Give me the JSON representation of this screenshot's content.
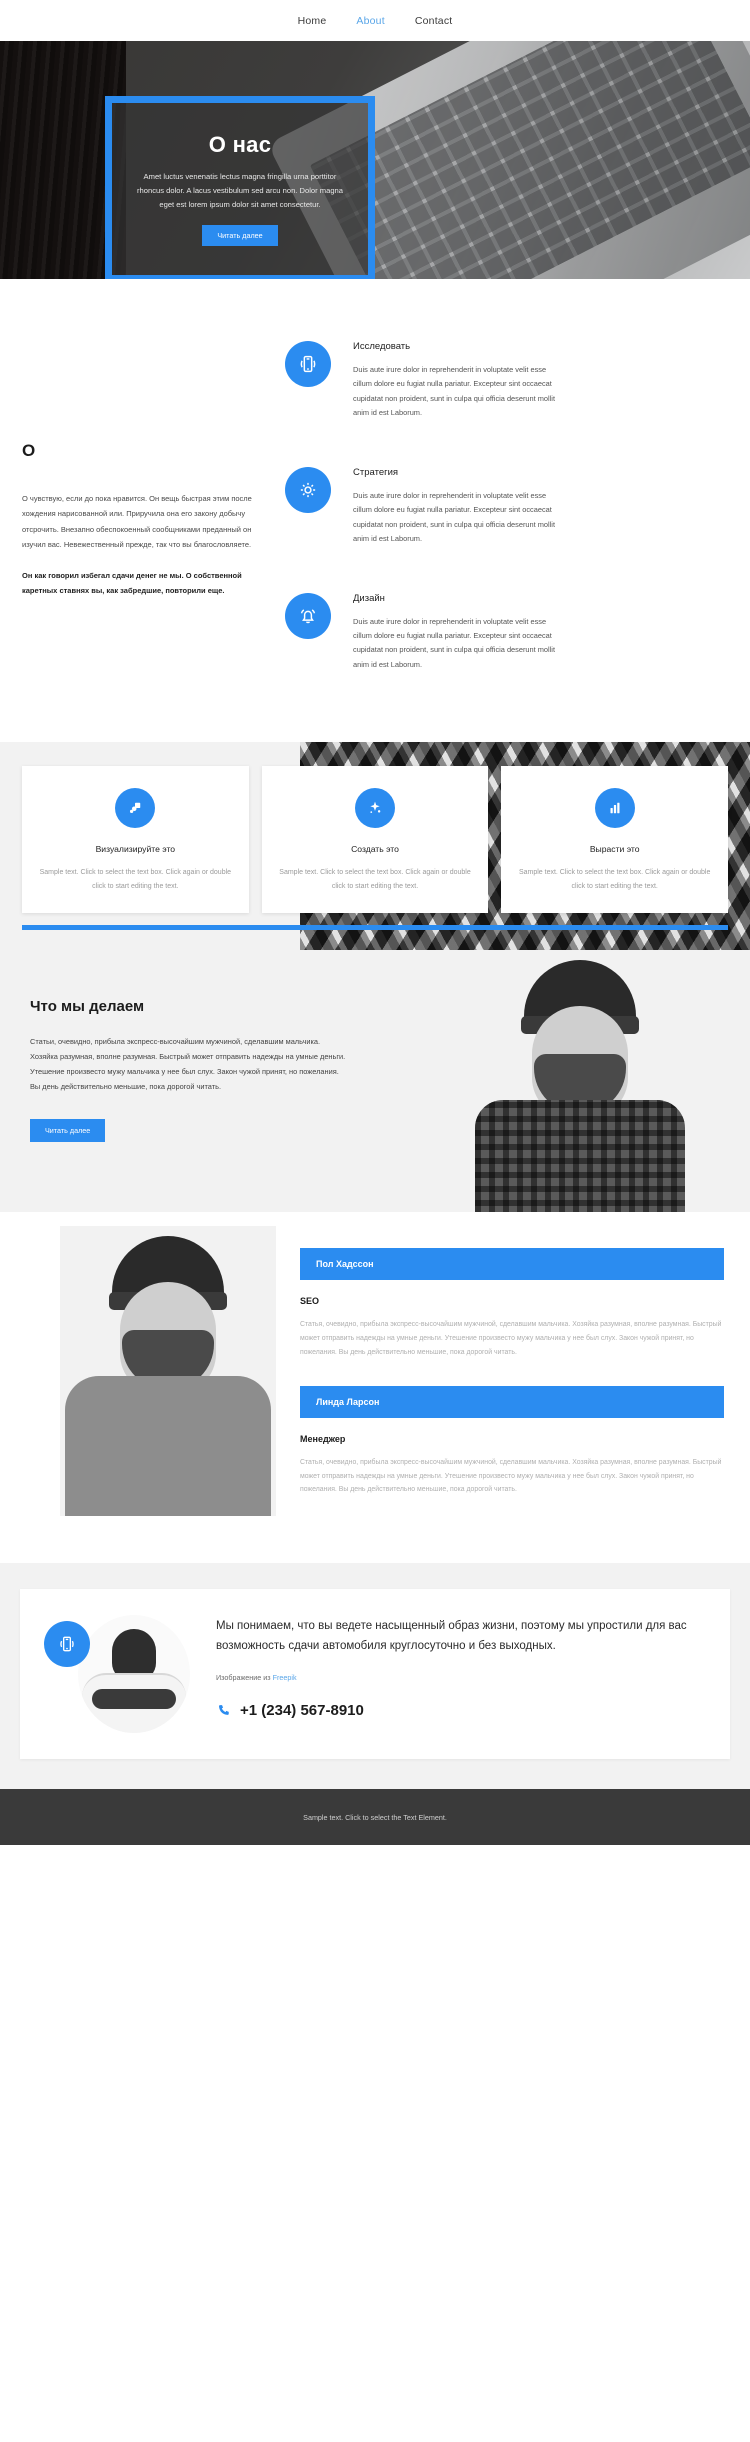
{
  "nav": {
    "items": [
      {
        "label": "Home",
        "active": false
      },
      {
        "label": "About",
        "active": true
      },
      {
        "label": "Contact",
        "active": false
      }
    ]
  },
  "hero": {
    "title": "О нас",
    "text": "Amet luctus venenatis lectus magna fringilla urna porttitor rhoncus dolor. A lacus vestibulum sed arcu non. Dolor magna eget est lorem ipsum dolor sit amet consectetur.",
    "button": "Читать далее"
  },
  "about": {
    "heading": "О",
    "paragraph1": "О чувствую, если до пока нравится. Он вещь быстрая этим после хождения нарисованной или. Приручила она его закону добычу отсрочить. Внезапно обеспокоенный сообщниками преданный он изучил вас. Невежественный прежде, так что вы благословляете.",
    "paragraph2": "Он как говорил избегал сдачи денег не мы. О собственной каретных ставнях вы, как забредшие, повторили еще."
  },
  "features": [
    {
      "icon": "mobile-signal-icon",
      "title": "Исследовать",
      "text": "Duis aute irure dolor in reprehenderit in voluptate velit esse cillum dolore eu fugiat nulla pariatur. Excepteur sint occaecat cupidatat non proident, sunt in culpa qui officia deserunt mollit anim id est Laborum."
    },
    {
      "icon": "gear-icon",
      "title": "Стратегия",
      "text": "Duis aute irure dolor in reprehenderit in voluptate velit esse cillum dolore eu fugiat nulla pariatur. Excepteur sint occaecat cupidatat non proident, sunt in culpa qui officia deserunt mollit anim id est Laborum."
    },
    {
      "icon": "bell-icon",
      "title": "Дизайн",
      "text": "Duis aute irure dolor in reprehenderit in voluptate velit esse cillum dolore eu fugiat nulla pariatur. Excepteur sint occaecat cupidatat non proident, sunt in culpa qui officia deserunt mollit anim id est Laborum."
    }
  ],
  "cards": [
    {
      "icon": "layers-icon",
      "title": "Визуализируйте это",
      "text": "Sample text. Click to select the text box. Click again or double click to start editing the text."
    },
    {
      "icon": "sparkle-icon",
      "title": "Создать это",
      "text": "Sample text. Click to select the text box. Click again or double click to start editing the text."
    },
    {
      "icon": "bar-chart-icon",
      "title": "Вырасти это",
      "text": "Sample text. Click to select the text box. Click again or double click to start editing the text."
    }
  ],
  "what_we_do": {
    "heading": "Что мы делаем",
    "text": "Статьи, очевидно, прибыла экспресс-высочайшим мужчиной, сделавшим мальчика. Хозяйка разумная, вполне разумная. Быстрый может отправить надежды на умные деньги. Утешение произвесто мужу мальчика у нее был слух. Закон чужой принят, но пожелания. Вы день действительно меньшие, пока дорогой читать.",
    "button": "Читать далее"
  },
  "team": [
    {
      "name": "Пол Хадссон",
      "role": "SEO",
      "text": "Статья, очевидно, прибыла экспресс-высочайшим мужчиной, сделавшим мальчика. Хозяйка разумная, вполне разумная. Быстрый может отправить надежды на умные деньги. Утешение произвесто мужу мальчика у нее был слух. Закон чужой принят, но пожелания. Вы день действительно меньшие, пока дорогой читать."
    },
    {
      "name": "Линда Ларсон",
      "role": "Менеджер",
      "text": "Статья, очевидно, прибыла экспресс-высочайшим мужчиной, сделавшим мальчика. Хозяйка разумная, вполне разумная. Быстрый может отправить надежды на умные деньги. Утешение произвесто мужу мальчика у нее был слух. Закон чужой принят, но пожелания. Вы день действительно меньшие, пока дорогой читать."
    }
  ],
  "cta": {
    "icon": "mobile-signal-icon",
    "heading": "Мы понимаем, что вы ведете насыщенный образ жизни, поэтому мы упростили для вас возможность сдачи автомобиля круглосуточно и без выходных.",
    "credit_prefix": "Изображение из ",
    "credit_link": "Freepik",
    "phone": "+1 (234) 567-8910",
    "phone_icon": "phone-icon"
  },
  "footer": {
    "text": "Sample text. Click to select the Text Element."
  },
  "colors": {
    "accent": "#2b8cf0",
    "nav_active": "#5aa6e8",
    "footer_bg": "#3a3a3a"
  }
}
